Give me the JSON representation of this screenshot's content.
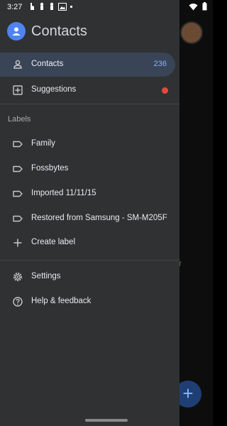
{
  "status": {
    "time": "3:27"
  },
  "app": {
    "title": "Contacts"
  },
  "drawer": {
    "contacts": {
      "label": "Contacts",
      "count": "236"
    },
    "suggestions": {
      "label": "Suggestions"
    },
    "labels_heading": "Labels",
    "labels": [
      "Family",
      "Fossbytes",
      "Imported 11/11/15",
      "Restored from Samsung - SM-M205F"
    ],
    "create_label": "Create label",
    "settings": "Settings",
    "help": "Help & feedback"
  },
  "background": {
    "partial_text": "r",
    "fab_symbol": "+"
  },
  "colors": {
    "accent": "#8ab4f8",
    "drawer_bg": "#303133",
    "active_bg": "#394457",
    "notification_dot": "#e64a3b",
    "annotation_arrow": "#ff1a1a"
  }
}
